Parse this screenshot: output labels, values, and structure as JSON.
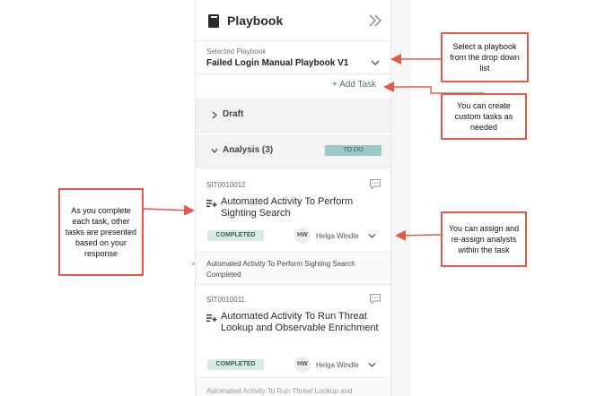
{
  "panel": {
    "title": "Playbook",
    "selected_label": "Selected Playbook",
    "selected_value": "Failed Login Manual Playbook V1",
    "add_task": "+ Add Task",
    "sections": [
      {
        "label": "Draft"
      },
      {
        "label": "Analysis (3)",
        "badge": "TO DO"
      }
    ],
    "tasks": [
      {
        "id": "SIT0010012",
        "title": "Automated Activity To Perform Sighting Search",
        "status": "COMPLETED",
        "avatar": "HW",
        "assignee": "Helga Windle"
      },
      {
        "id": "SIT0010011",
        "title": "Automated Activity To Run Threat Lookup and Observable Enrichment",
        "status": "COMPLETED",
        "avatar": "HW",
        "assignee": "Helga Windle"
      }
    ],
    "next_info": {
      "line1": "Automated Activity To Perform Sighting Search",
      "line2": "Completed"
    },
    "next_info_bottom": "Automated Activity To Run Threat Lookup and"
  },
  "callouts": {
    "playbook": "Select a playbook from the drop down list",
    "custom": "You can create custom tasks as needed",
    "complete": "As you complete each task, other tasks are presented based on your response",
    "assign": "You can assign and re-assign analysts within the task"
  },
  "edge_mark": ">",
  "colors": {
    "callout_border": "#e8584a",
    "todo_badge": "#9fc7c8",
    "completed_badge": "#dbe9e4",
    "accent_text": "#4d6e6e"
  }
}
